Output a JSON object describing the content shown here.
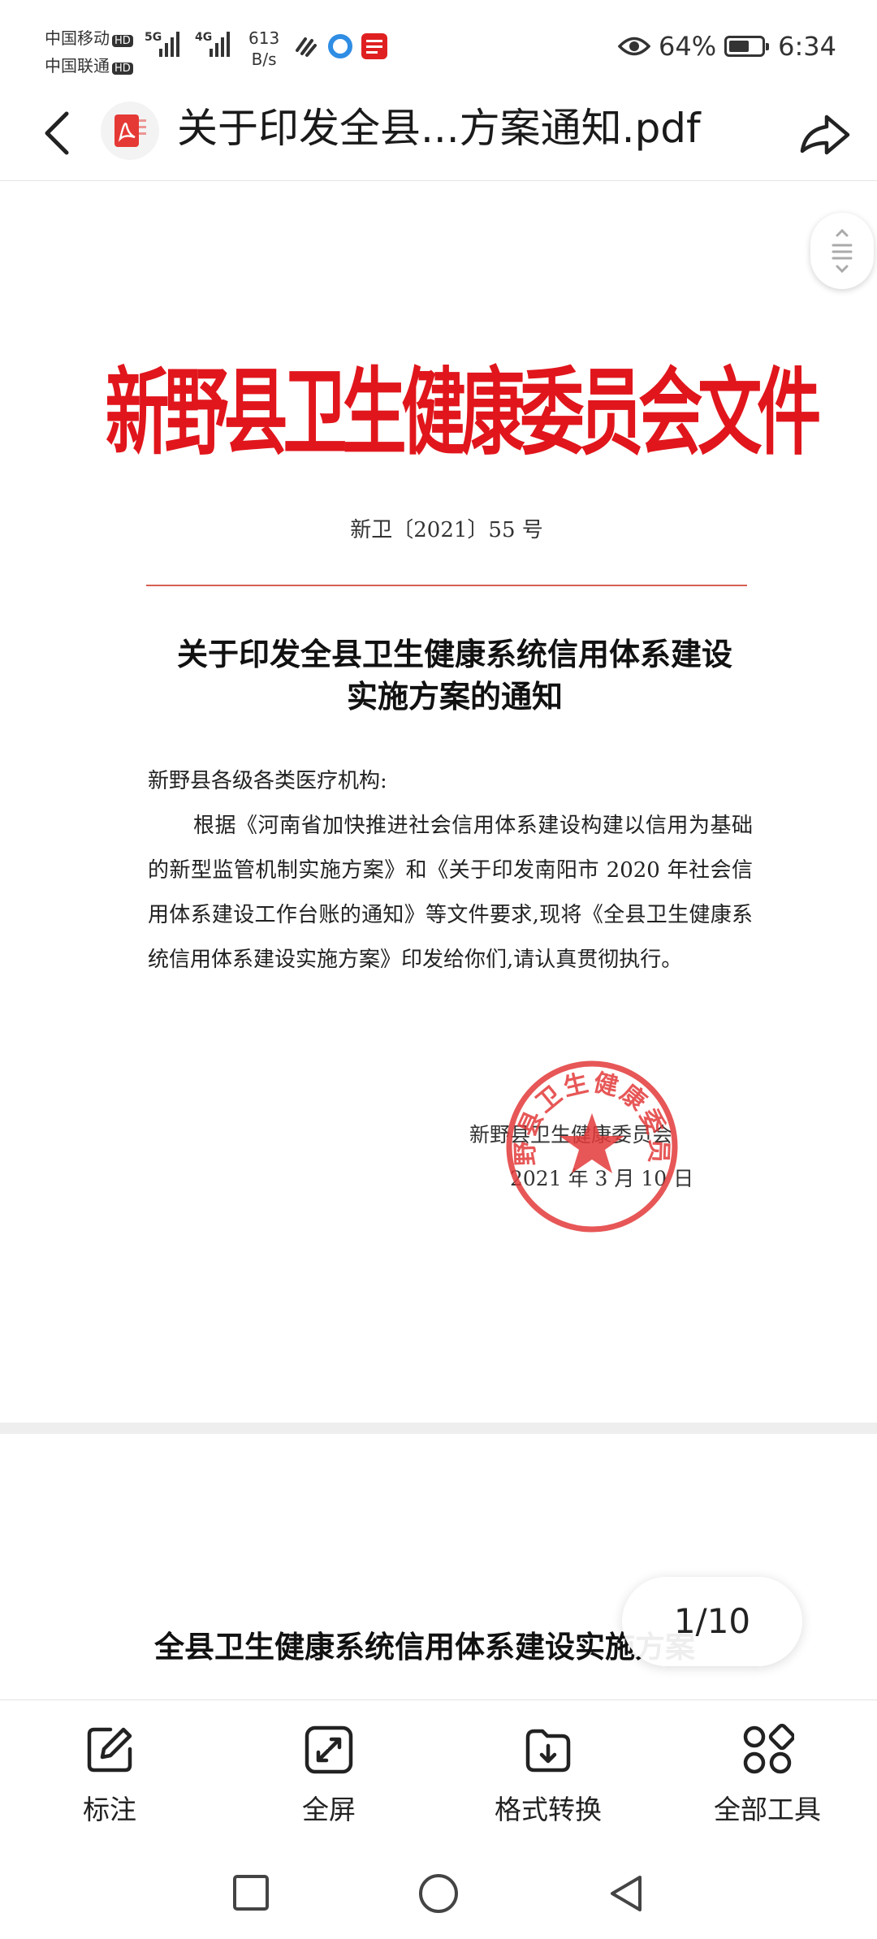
{
  "status_bar": {
    "carrier1": "中国移动",
    "carrier2": "中国联通",
    "hd": "HD",
    "net1": "5G",
    "net2": "4G",
    "speed_value": "613",
    "speed_unit": "B/s",
    "battery_percent": "64%",
    "battery_level": 0.64,
    "time": "6:34"
  },
  "titlebar": {
    "title": "关于印发全县...方案通知.pdf"
  },
  "document": {
    "header": "新野县卫生健康委员会文件",
    "doc_number": "新卫〔2021〕55 号",
    "title_line1": "关于印发全县卫生健康系统信用体系建设",
    "title_line2": "实施方案的通知",
    "salutation": "新野县各级各类医疗机构:",
    "paragraph": "根据《河南省加快推进社会信用体系建设构建以信用为基础的新型监管机制实施方案》和《关于印发南阳市 2020 年社会信用体系建设工作台账的通知》等文件要求,现将《全县卫生健康系统信用体系建设实施方案》印发给你们,请认真贯彻执行。",
    "signature_org": "新野县卫生健康委员会",
    "signature_date": "2021 年 3 月 10 日",
    "seal_text": "新野县卫生健康委员会",
    "page2_title": "全县卫生健康系统信用体系建设实施方案"
  },
  "page_indicator": "1/10",
  "toolbar": {
    "annotate": "标注",
    "fullscreen": "全屏",
    "convert": "格式转换",
    "all_tools": "全部工具"
  },
  "colors": {
    "header_red": "#e0161c",
    "pdf_red": "#e53935"
  }
}
